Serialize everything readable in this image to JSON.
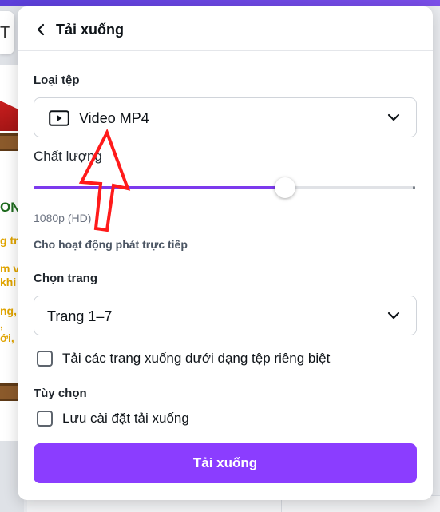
{
  "background": {
    "top_button_glyph": "T",
    "fragments": [
      "ONG",
      "g tr",
      "m v",
      "khi",
      "ng,",
      ",",
      "ới,"
    ]
  },
  "panel": {
    "title": "Tải xuống",
    "file_type": {
      "label": "Loại tệp",
      "value": "Video MP4",
      "icon": "play-icon"
    },
    "quality": {
      "label": "Chất lượng",
      "level_percent": 66,
      "resolution": "1080p (HD)",
      "helper": "Cho hoạt động phát trực tiếp"
    },
    "pages": {
      "label": "Chọn trang",
      "value": "Trang 1–7"
    },
    "separate_files": {
      "label": "Tải các trang xuống dưới dạng tệp riêng biệt",
      "checked": false
    },
    "options": {
      "label": "Tùy chọn",
      "save_settings": {
        "label": "Lưu cài đặt tải xuống",
        "checked": false
      }
    },
    "download_button": "Tải xuống"
  },
  "colors": {
    "accent": "#8b3dff",
    "slider_fill": "#7c3aed",
    "annotation": "#ff1a1a"
  }
}
